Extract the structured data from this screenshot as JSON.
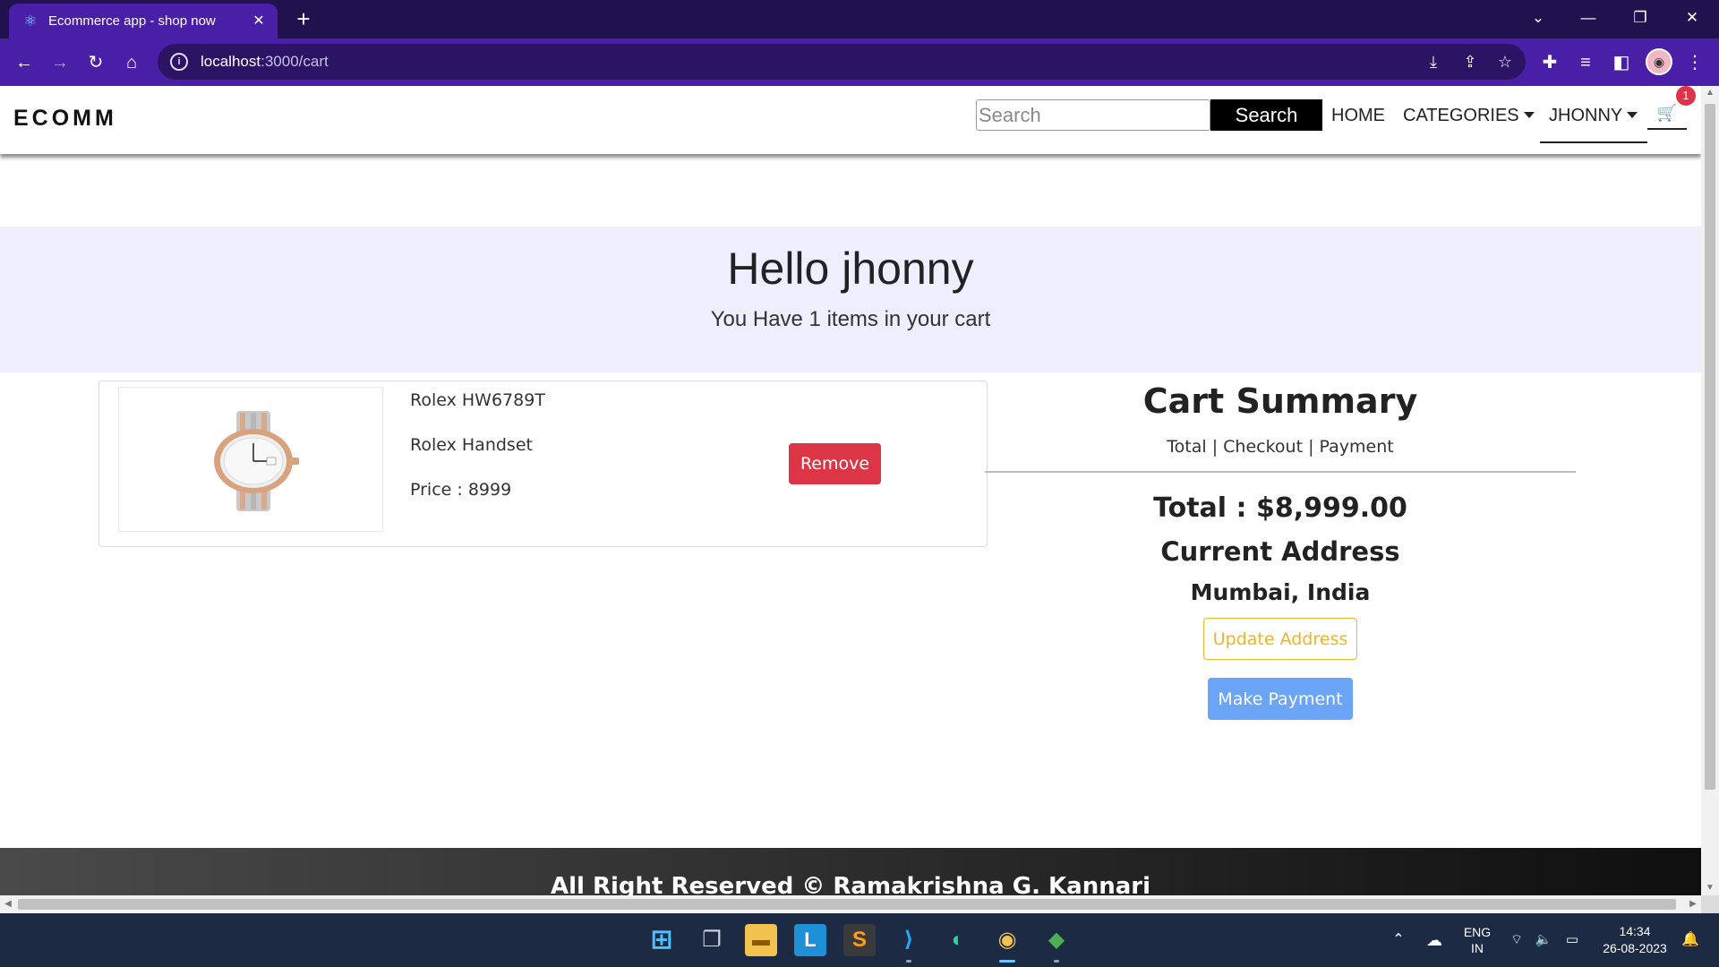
{
  "browser": {
    "tab_title": "Ecommerce app - shop now",
    "tab_close": "✕",
    "new_tab": "+",
    "url_host": "localhost",
    "url_path": ":3000/cart"
  },
  "site": {
    "brand": "ECOMM",
    "search_placeholder": "Search",
    "search_button": "Search",
    "nav": {
      "home": "HOME",
      "categories": "CATEGORIES",
      "user": "JHONNY"
    },
    "cart_count": "1"
  },
  "greeting": {
    "title": "Hello jhonny",
    "subtitle": "You Have 1 items in your cart"
  },
  "cart_items": [
    {
      "name": "Rolex HW6789T",
      "description": "Rolex Handset",
      "price": "Price : 8999",
      "remove_label": "Remove"
    }
  ],
  "summary": {
    "title": "Cart Summary",
    "subtitle": "Total | Checkout | Payment",
    "total": "Total : $8,999.00",
    "address_heading": "Current Address",
    "address": "Mumbai, India",
    "update_address": "Update Address",
    "make_payment": "Make Payment"
  },
  "footer": {
    "text": "All Right Reserved © Ramakrishna G. Kannari"
  },
  "taskbar": {
    "lang_top": "ENG",
    "lang_bottom": "IN",
    "time": "14:34",
    "date": "26-08-2023"
  },
  "colors": {
    "browser_frame": "#22114f",
    "browser_toolbar": "#4a1fa8",
    "greeting_bg": "#eeeeff",
    "remove": "#dc3545",
    "update_address": "#f0b429",
    "make_payment": "#6aa5f7",
    "badge": "#e0334a"
  }
}
